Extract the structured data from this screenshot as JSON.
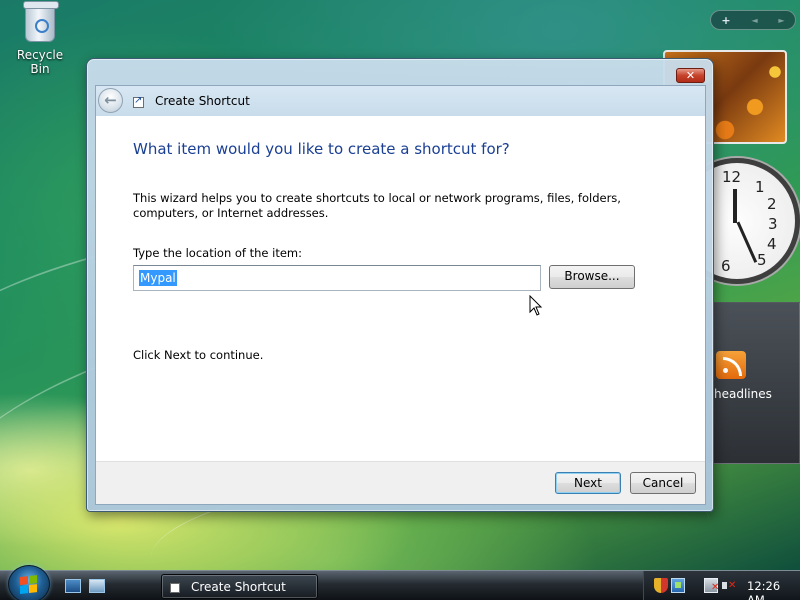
{
  "desktop": {
    "recycle_bin_label": "Recycle Bin",
    "sidebar": {
      "add_gadget": "+",
      "prev": "◄",
      "next": "►",
      "feed_label": "headlines"
    }
  },
  "wizard": {
    "title": "Create Shortcut",
    "close_label": "✕",
    "heading": "What item would you like to create a shortcut for?",
    "description": "This wizard helps you to create shortcuts to local or network programs, files, folders, computers, or Internet addresses.",
    "location_label": "Type the location of the item:",
    "location_value": "Mypal",
    "browse_label": "Browse...",
    "continue_text": "Click Next to continue.",
    "next_label": "Next",
    "cancel_label": "Cancel"
  },
  "taskbar": {
    "active_window": "Create Shortcut",
    "clock": "12:26 AM"
  },
  "colors": {
    "heading": "#1a3f93",
    "selection": "#3399ff",
    "close_button": "#c6422b"
  }
}
